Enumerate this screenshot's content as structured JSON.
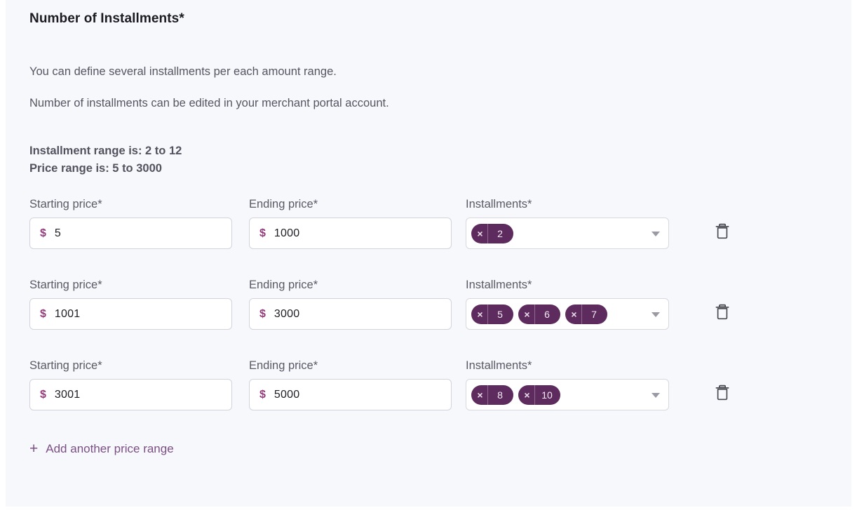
{
  "section": {
    "title": "Number of Installments*",
    "descriptions": [
      "You can define several installments per each amount range.",
      "Number of installments can be edited in your merchant portal account."
    ],
    "range_info": [
      "Installment range is: 2 to 12",
      "Price range is: 5 to 3000"
    ]
  },
  "labels": {
    "starting_price": "Starting price*",
    "ending_price": "Ending price*",
    "installments": "Installments*",
    "currency_symbol": "$"
  },
  "icons": {
    "delete": "trash-icon",
    "caret": "chevron-down-icon",
    "chip_remove": "close-icon",
    "add": "plus-icon"
  },
  "colors": {
    "chip_background": "#5d2b5e",
    "accent_link": "#7a4f84",
    "currency": "#963a7c",
    "panel_background": "#f7f8fc",
    "input_border": "#d8d8e0"
  },
  "rows": [
    {
      "starting_price": "5",
      "ending_price": "1000",
      "installments": [
        "2"
      ]
    },
    {
      "starting_price": "1001",
      "ending_price": "3000",
      "installments": [
        "5",
        "6",
        "7"
      ]
    },
    {
      "starting_price": "3001",
      "ending_price": "5000",
      "installments": [
        "8",
        "10"
      ]
    }
  ],
  "add_row": {
    "plus": "+",
    "label": "Add another price range"
  }
}
